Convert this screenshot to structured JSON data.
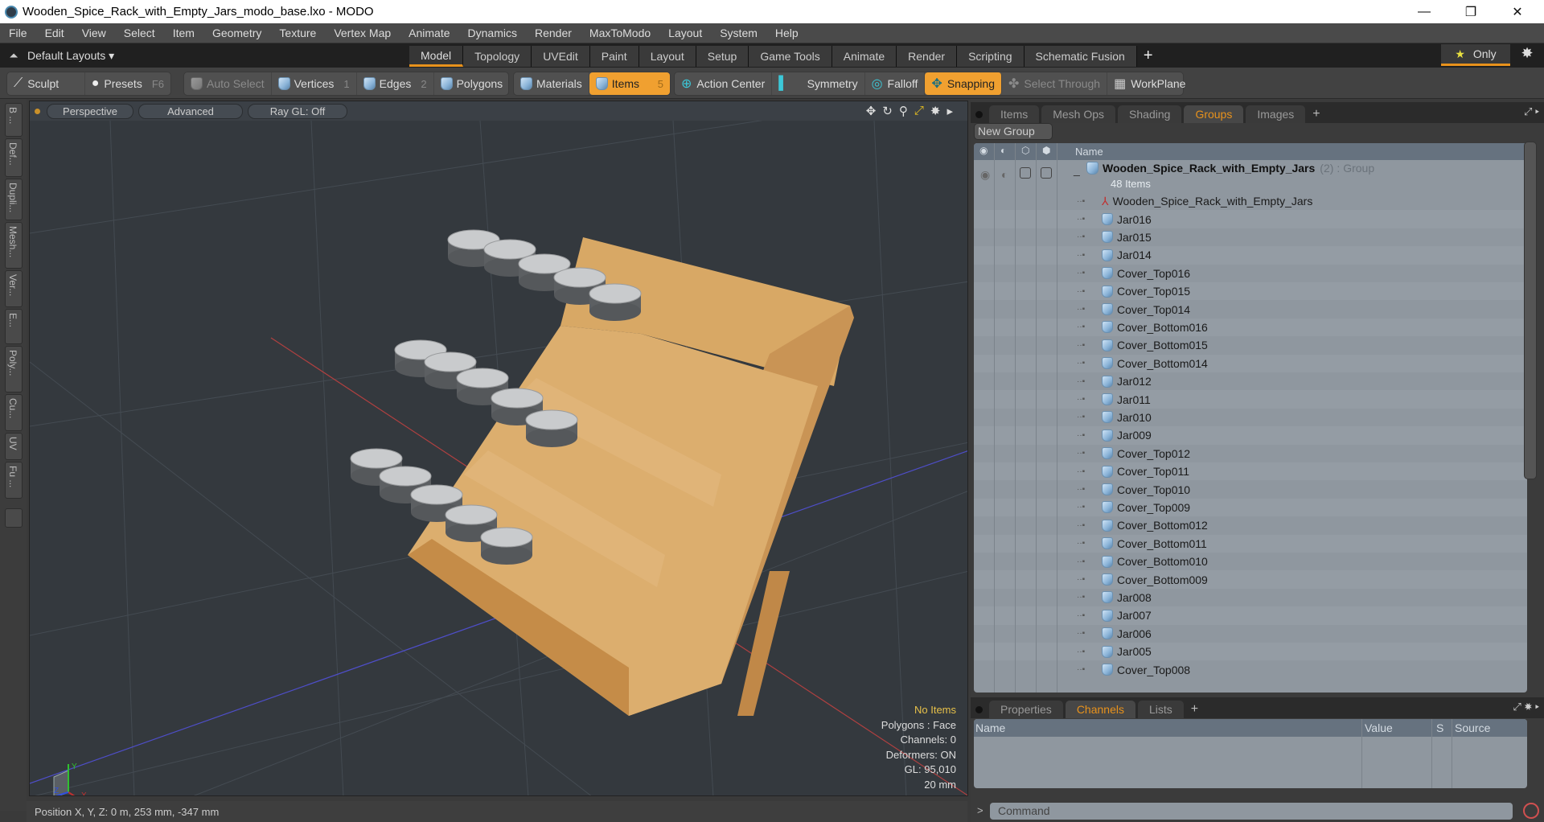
{
  "window": {
    "title": "Wooden_Spice_Rack_with_Empty_Jars_modo_base.lxo - MODO",
    "controls": {
      "minimize": "—",
      "maximize": "❐",
      "close": "✕"
    }
  },
  "menu": [
    "File",
    "Edit",
    "View",
    "Select",
    "Item",
    "Geometry",
    "Texture",
    "Vertex Map",
    "Animate",
    "Dynamics",
    "Render",
    "MaxToModo",
    "Layout",
    "System",
    "Help"
  ],
  "layoutbar": {
    "default_layouts": "Default Layouts ▾",
    "tabs": [
      "Model",
      "Topology",
      "UVEdit",
      "Paint",
      "Layout",
      "Setup",
      "Game Tools",
      "Animate",
      "Render",
      "Scripting",
      "Schematic Fusion"
    ],
    "active_tab": "Model",
    "add": "+",
    "only_label": "Only",
    "star": "★",
    "gear": "✸"
  },
  "toolbar": {
    "sculpt": "Sculpt",
    "presets": "Presets",
    "presets_key": "F6",
    "auto_select": "Auto Select",
    "vertices": "Vertices",
    "vertices_key": "1",
    "edges": "Edges",
    "edges_key": "2",
    "polygons": "Polygons",
    "materials": "Materials",
    "items": "Items",
    "items_key": "5",
    "action_center": "Action Center",
    "symmetry": "Symmetry",
    "falloff": "Falloff",
    "snapping": "Snapping",
    "select_through": "Select Through",
    "workplane": "WorkPlane"
  },
  "left_tabs": [
    "B ...",
    "Def...",
    "Dupli...",
    "Mesh...",
    "Ver...",
    "E...",
    "Poly...",
    "Cu...",
    "UV",
    "Fu ..."
  ],
  "viewport": {
    "view": "Perspective",
    "shading": "Advanced",
    "raygl": "Ray GL: Off",
    "info": {
      "selection": "No Items",
      "polygons": "Polygons : Face",
      "channels": "Channels: 0",
      "deformers": "Deformers: ON",
      "gl": "GL: 95,010",
      "grid": "20 mm"
    },
    "axes": {
      "x": "X",
      "y": "Y",
      "z": "Z"
    }
  },
  "status": {
    "position": "Position X, Y, Z:   0 m, 253 mm, -347 mm"
  },
  "groups_panel": {
    "tabs": [
      "Items",
      "Mesh Ops",
      "Shading",
      "Groups",
      "Images"
    ],
    "active_tab": "Groups",
    "new_group": "New Group",
    "column_name": "Name",
    "group": {
      "name": "Wooden_Spice_Rack_with_Empty_Jars",
      "count": "(2)",
      "type": ": Group",
      "sub": "48 Items"
    },
    "items": [
      "Wooden_Spice_Rack_with_Empty_Jars",
      "Jar016",
      "Jar015",
      "Jar014",
      "Cover_Top016",
      "Cover_Top015",
      "Cover_Top014",
      "Cover_Bottom016",
      "Cover_Bottom015",
      "Cover_Bottom014",
      "Jar012",
      "Jar011",
      "Jar010",
      "Jar009",
      "Cover_Top012",
      "Cover_Top011",
      "Cover_Top010",
      "Cover_Top009",
      "Cover_Bottom012",
      "Cover_Bottom011",
      "Cover_Bottom010",
      "Cover_Bottom009",
      "Jar008",
      "Jar007",
      "Jar006",
      "Jar005",
      "Cover_Top008"
    ]
  },
  "channels_panel": {
    "tabs": [
      "Properties",
      "Channels",
      "Lists"
    ],
    "active_tab": "Channels",
    "columns": [
      "Name",
      "Value",
      "S",
      "Source"
    ]
  },
  "command": {
    "placeholder": "Command",
    "prompt": ">"
  }
}
